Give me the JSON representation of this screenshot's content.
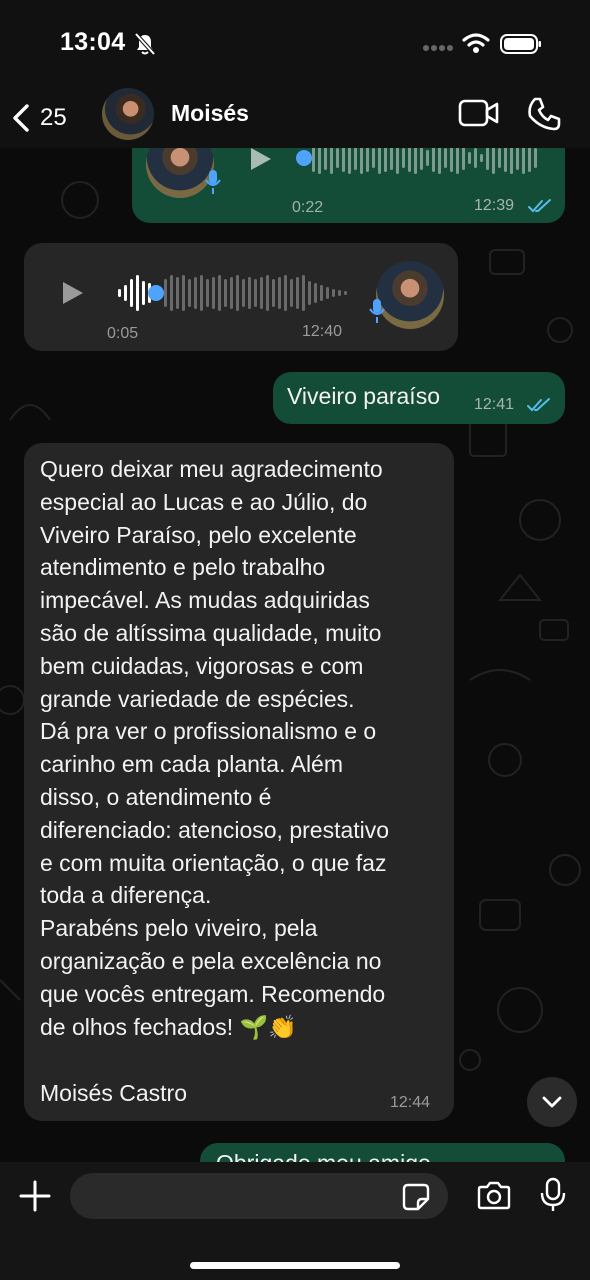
{
  "status_bar": {
    "time": "13:04"
  },
  "header": {
    "back_count": "25",
    "contact_name": "Moisés"
  },
  "messages": {
    "voice_out": {
      "duration": "0:22",
      "time": "12:39"
    },
    "voice_in": {
      "duration": "0:05",
      "time": "12:40"
    },
    "text_out": {
      "text": "Viveiro paraíso",
      "time": "12:41"
    },
    "long_in": {
      "text": "Quero deixar meu agradecimento\nespecial ao Lucas e ao Júlio, do\nViveiro Paraíso, pelo excelente\natendimento e pelo trabalho\nimpecável. As mudas adquiridas\nsão de altíssima qualidade, muito\nbem cuidadas, vigorosas e com\ngrande variedade de espécies.\nDá pra ver o profissionalismo e o\ncarinho em cada planta. Além\ndisso, o atendimento é\ndiferenciado: atencioso, prestativo\ne com muita orientação, o que faz\ntoda a diferença.\nParabéns pelo viveiro, pela\norganização e pela excelência no\nque vocês entregam. Recomendo\nde olhos fechados! 🌱👏",
      "signature": "Moisés Castro",
      "time": "12:44"
    },
    "partial_out": {
      "text": "Obrigado meu amigo"
    }
  },
  "colors": {
    "outgoing_bubble": "#144d37",
    "incoming_bubble": "#262626",
    "accent_blue": "#4ea3ff",
    "read_ticks": "#53bdeb"
  }
}
